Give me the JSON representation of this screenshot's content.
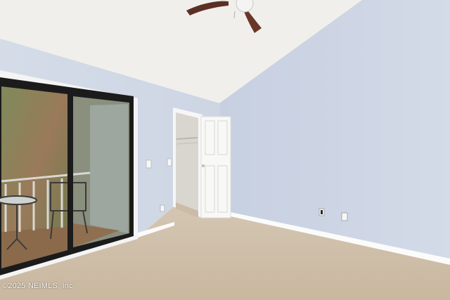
{
  "watermark": {
    "text": "©2025 NEIMLS, Inc"
  },
  "colors": {
    "ceiling": "#f1f0ec",
    "wall_left": "#d6dde8",
    "wall_right": "#c9d2e3",
    "carpet": "#d8c9b5",
    "trim": "#ffffff",
    "door": "#f7f7f5",
    "door_frame": "#1b1b1b",
    "deck": "#8a6a4b"
  },
  "icons": [
    "ceiling-fan-icon",
    "light-switch-icon",
    "outlet-icon"
  ]
}
